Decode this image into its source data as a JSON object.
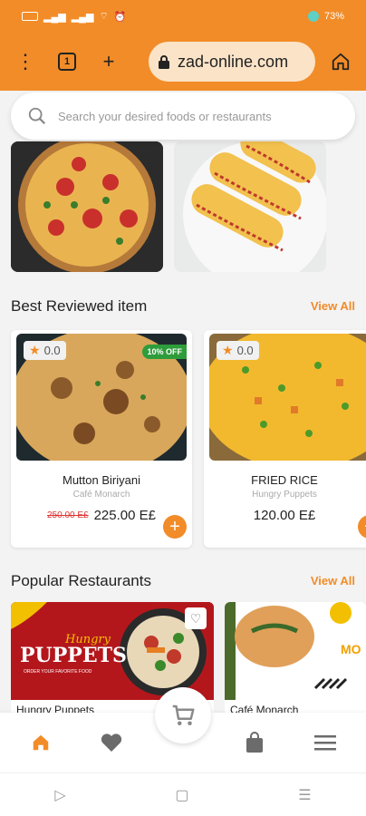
{
  "status_bar": {
    "right_text": "73%"
  },
  "browser": {
    "url": "zad-online.com"
  },
  "search": {
    "placeholder": "Search your desired foods or restaurants"
  },
  "best_reviewed": {
    "title": "Best Reviewed item",
    "view_all": "View All",
    "items": [
      {
        "name": "Mutton Biriyani",
        "restaurant": "Café Monarch",
        "rating": "0.0",
        "old_price": "250.00 E£",
        "price": "225.00 E£",
        "badge": "10% OFF"
      },
      {
        "name": "FRIED RICE",
        "restaurant": "Hungry Puppets",
        "rating": "0.0",
        "price": "120.00 E£"
      }
    ]
  },
  "popular": {
    "title": "Popular Restaurants",
    "view_all": "View All",
    "restaurants": [
      {
        "name": "Hungry Puppets",
        "banner_title": "PUPPETS",
        "banner_script": "Hungry",
        "banner_sub": "ORDER YOUR FAVORITE FOOD"
      },
      {
        "name": "Café Monarch",
        "banner_text": "MO"
      }
    ]
  },
  "colors": {
    "accent": "#f28c28",
    "discount": "#2e9c3b"
  }
}
